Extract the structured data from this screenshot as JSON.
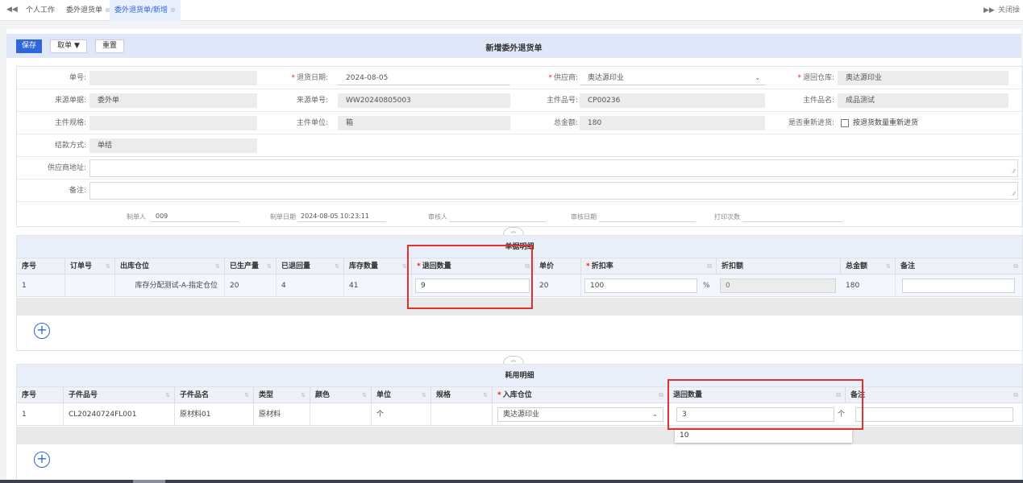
{
  "tabs": {
    "nav_left": "◀◀",
    "items": [
      {
        "label": "个人工作",
        "closable": false,
        "active": false
      },
      {
        "label": "委外退货单",
        "closable": true,
        "active": false
      },
      {
        "label": "委外退货单/新增",
        "closable": true,
        "active": true
      }
    ],
    "nav_right": "▶▶",
    "close_label": "关闭操"
  },
  "toolbar": {
    "save_label": "保存",
    "fetch_label": "取单 ▼",
    "reset_label": "重置",
    "title": "新增委外退货单"
  },
  "form": {
    "order_no": {
      "label": "单号:",
      "value": ""
    },
    "return_date": {
      "label": "退货日期:",
      "value": "2024-08-05",
      "required": true
    },
    "supplier": {
      "label": "供应商:",
      "value": "奥达源印业",
      "required": true
    },
    "return_warehouse": {
      "label": "退回仓库:",
      "value": "奥达源印业",
      "required": true
    },
    "source_doc": {
      "label": "来源单据:",
      "value": "委外单"
    },
    "source_no": {
      "label": "来源单号:",
      "value": "WW20240805003"
    },
    "main_part_no": {
      "label": "主件品号:",
      "value": "CP00236"
    },
    "main_part_name": {
      "label": "主件品名:",
      "value": "成品测试"
    },
    "main_spec": {
      "label": "主件规格:",
      "value": ""
    },
    "main_unit": {
      "label": "主件单位:",
      "value": "箱"
    },
    "total_amount": {
      "label": "总金额:",
      "value": "180"
    },
    "reentry": {
      "label": "是否重新进货:",
      "checkbox_label": "按退货数量重新进货",
      "checked": false
    },
    "settlement": {
      "label": "结款方式:",
      "value": "单结"
    },
    "supplier_address": {
      "label": "供应商地址:",
      "value": ""
    },
    "remark": {
      "label": "备注:",
      "value": ""
    }
  },
  "signature": {
    "creator_label": "制单人",
    "creator": "009",
    "created_at_label": "制单日期",
    "created_at": "2024-08-05 10:23:11",
    "reviewer_label": "审核人",
    "reviewer": "",
    "review_date_label": "审核日期",
    "review_date": "",
    "print_count_label": "打印次数",
    "print_count": ""
  },
  "detail": {
    "title": "单据明细",
    "columns": {
      "seq": "序号",
      "order_no": "订单号",
      "out_warehouse": "出库仓位",
      "produced": "已生产量",
      "returned": "已退回量",
      "stock": "库存数量",
      "return_qty": "退回数量",
      "price": "单价",
      "discount_rate": "折扣率",
      "discount_amount": "折扣额",
      "total": "总金额",
      "remark": "备注"
    },
    "rows": [
      {
        "seq": "1",
        "order_no": "",
        "out_warehouse": "库存分配测试-A-指定仓位",
        "produced": "20",
        "returned": "4",
        "stock": "41",
        "return_qty": "9",
        "price": "20",
        "discount_rate": "100",
        "discount_unit": "%",
        "discount_amount": "0",
        "total": "180",
        "remark": ""
      }
    ],
    "add_symbol": "+"
  },
  "consumption": {
    "title": "耗用明细",
    "columns": {
      "seq": "序号",
      "child_no": "子件品号",
      "child_name": "子件品名",
      "type": "类型",
      "color": "颜色",
      "unit": "单位",
      "spec": "规格",
      "in_warehouse": "入库仓位",
      "return_qty": "退回数量",
      "remark": "备注"
    },
    "rows": [
      {
        "seq": "1",
        "child_no": "CL20240724FL001",
        "child_name": "原材料01",
        "type": "原材料",
        "color": "",
        "unit": "个",
        "spec": "",
        "in_warehouse": "奥达源印业",
        "return_qty": "3",
        "return_unit": "个",
        "remark": ""
      }
    ],
    "autocomplete_value": "10",
    "add_symbol": "+"
  },
  "icons": {
    "collapse": "chevron-up-icon",
    "sort": "sort-icon",
    "edit": "edit-icon",
    "add": "add-circle-icon"
  },
  "colors": {
    "primary": "#2f66d9",
    "highlight": "#e03030",
    "required": "#e22222"
  }
}
